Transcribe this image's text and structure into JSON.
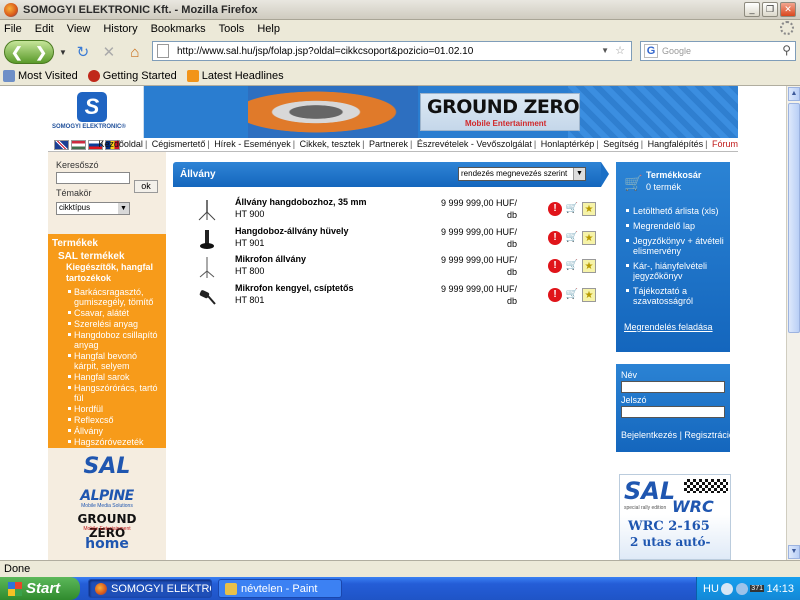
{
  "window": {
    "title": "SOMOGYI ELEKTRONIC Kft. - Mozilla Firefox"
  },
  "menubar": [
    "File",
    "Edit",
    "View",
    "History",
    "Bookmarks",
    "Tools",
    "Help"
  ],
  "navbar": {
    "url": "http://www.sal.hu/jsp/folap.jsp?oldal=cikkcsoport&pozicio=01.02.10",
    "search_placeholder": "Google"
  },
  "bookmarks": [
    "Most Visited",
    "Getting Started",
    "Latest Headlines"
  ],
  "status": "Done",
  "site": {
    "logo_text": "SOMOGYI ELEKTRONIC®",
    "banner_title": "GROUND ZERO",
    "banner_sub": "Mobile Entertainment",
    "topnav": [
      "Kezdőoldal",
      "Cégismertető",
      "Hírek - Események",
      "Cikkek, tesztek",
      "Partnerek",
      "Észrevételek - Vevőszolgálat",
      "Honlaptérkép",
      "Segítség",
      "Hangfalépítés",
      "Fórum"
    ]
  },
  "sidebar": {
    "search_label": "Keresőszó",
    "search_button": "ok",
    "topic_label": "Témakör",
    "topic_value": "cikktípus",
    "menu_title": "Termékek",
    "menu_sub": "SAL termékek",
    "menu_group": "Kiegészítők, hangfal tartozékok",
    "menu_items": [
      "Barkácsragasztó, gumiszegély, tömítő",
      "Csavar, alátét",
      "Szerelési anyag",
      "Hangdoboz csillapító anyag",
      "Hangfal bevonó kárpit, selyem",
      "Hangfal sarok",
      "Hangszórórács, tartó fül",
      "Hordfül",
      "Reflexcső",
      "Állvány",
      "Hagszóróvezeték"
    ],
    "brands": [
      "SAL",
      "ALPINE",
      "Mobile Media Solutions",
      "GROUND ZERO",
      "Mobile Entertainment",
      "home"
    ]
  },
  "main": {
    "title": "Állvány",
    "sort_value": "rendezés megnevezés szerint",
    "products": [
      {
        "name": "Állvány hangdobozhoz, 35 mm",
        "code": "HT 900",
        "price": "9 999 999,00 HUF/",
        "unit": "db"
      },
      {
        "name": "Hangdoboz-állvány hüvely",
        "code": "HT 901",
        "price": "9 999 999,00 HUF/",
        "unit": "db"
      },
      {
        "name": "Mikrofon állvány",
        "code": "HT 800",
        "price": "9 999 999,00 HUF/",
        "unit": "db"
      },
      {
        "name": "Mikrofon kengyel, csíptetős",
        "code": "HT 801",
        "price": "9 999 999,00 HUF/",
        "unit": "db"
      }
    ]
  },
  "cart": {
    "title": "Termékkosár",
    "count": "0 termék",
    "links": [
      "Letölthető árlista (xls)",
      "Megrendelő lap",
      "Jegyzőkönyv + átvételi elismervény",
      "Kár-, hiányfelvételi jegyzőkönyv",
      "Tájékoztató a szavatosságról"
    ],
    "order": "Megrendelés feladása"
  },
  "login": {
    "name_label": "Név",
    "pass_label": "Jelszó",
    "login_link": "Bejelentkezés",
    "separator": "|",
    "register_link": "Regisztráció"
  },
  "ad": {
    "brand": "SAL",
    "wrc": "WRC",
    "small": "special rally edition",
    "model": "WRC 2-165",
    "seats": "2 utas autó-"
  },
  "taskbar": {
    "start": "Start",
    "tasks": [
      "SOMOGYI ELEKTRON...",
      "névtelen - Paint"
    ],
    "lang": "HU",
    "badge": "371",
    "time": "14:13"
  }
}
